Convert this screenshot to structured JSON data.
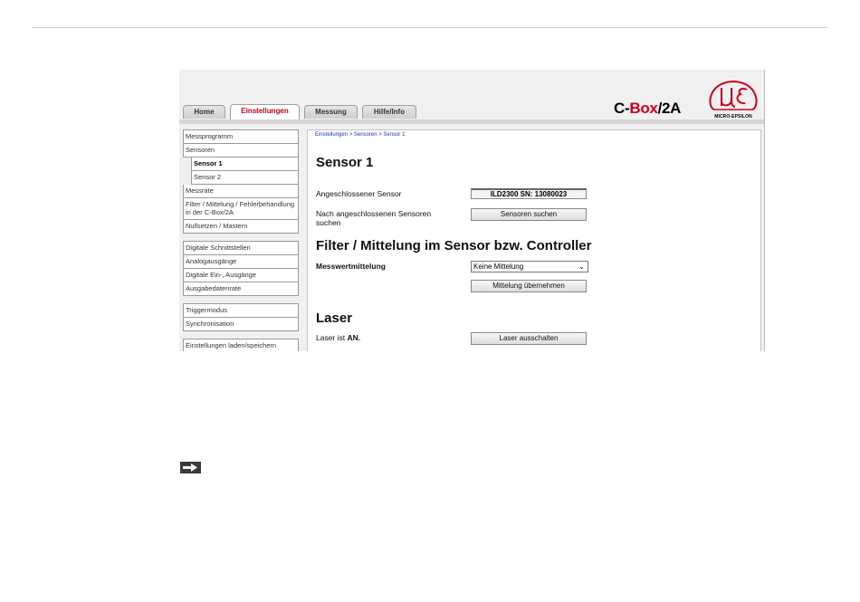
{
  "tabs": [
    {
      "label": "Home",
      "active": false
    },
    {
      "label": "Einstellungen",
      "active": true
    },
    {
      "label": "Messung",
      "active": false
    },
    {
      "label": "Hilfe/Info",
      "active": false
    }
  ],
  "product": {
    "prefix": "C-",
    "highlight": "Box",
    "suffix": "/2A"
  },
  "logo": {
    "text": "MICRO-EPSILON"
  },
  "sidebar": {
    "group1": [
      "Messprogramm",
      "Sensoren",
      "Sensor 1",
      "Sensor 2",
      "Messrate",
      "Filter / Mittelung / Fehlerbehandlung in der C-Box/2A",
      "Nullsetzen / Mastern"
    ],
    "group2": [
      "Digitale Schnittstellen",
      "Analogausgänge",
      "Digitale Ein-, Ausgänge",
      "Ausgabedatenrate"
    ],
    "group3": [
      "Triggermodus",
      "Synchronisation"
    ],
    "group4": [
      "Einstellungen laden/speichern"
    ]
  },
  "main": {
    "breadcrumb": "Einstellungen > Sensoren > Sensor 1",
    "title": "Sensor 1",
    "connected_label": "Angeschlossener Sensor",
    "connected_value": "ILD2300 SN: 13080023",
    "search_label": "Nach angeschlossenen Sensoren suchen",
    "search_button": "Sensoren suchen",
    "filter_title": "Filter / Mittelung im Sensor bzw. Controller",
    "averaging_label": "Messwertmittelung",
    "averaging_value": "Keine Mittelung",
    "apply_button": "Mittelung übernehmen",
    "laser_title": "Laser",
    "laser_status_prefix": "Laser ist ",
    "laser_status_value": "AN.",
    "laser_button": "Laser ausschalten"
  },
  "colors": {
    "accent": "#d0021b",
    "link": "#2233aa"
  }
}
